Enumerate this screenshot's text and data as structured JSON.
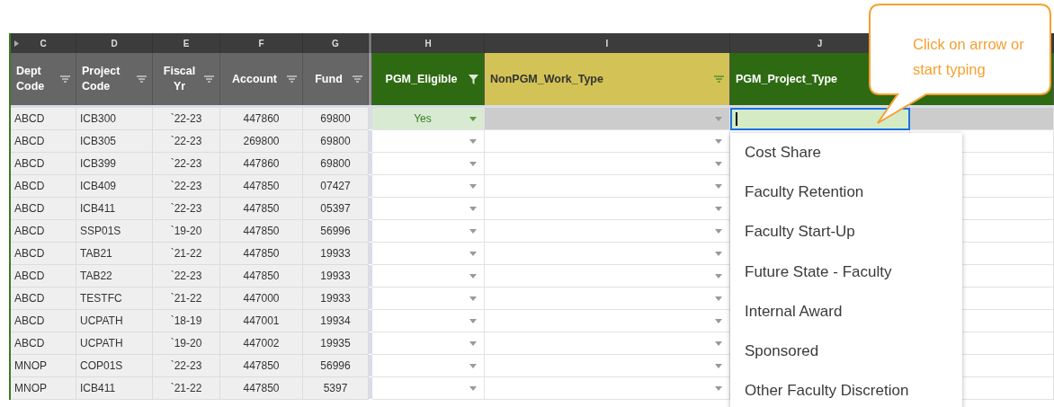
{
  "columns": [
    {
      "letter": "C",
      "label": "Dept Code",
      "color": "#666666",
      "filter_active": false
    },
    {
      "letter": "D",
      "label": "Project Code",
      "color": "#666666",
      "filter_active": false
    },
    {
      "letter": "E",
      "label": "Fiscal Yr",
      "color": "#666666",
      "filter_active": false
    },
    {
      "letter": "F",
      "label": "Account",
      "color": "#666666",
      "filter_active": false
    },
    {
      "letter": "G",
      "label": "Fund",
      "color": "#666666",
      "filter_active": false
    },
    {
      "letter": "H",
      "label": "PGM_Eligible",
      "color": "#2e6a12",
      "filter_active": true
    },
    {
      "letter": "I",
      "label": "NonPGM_Work_Type",
      "color": "#d3c356",
      "filter_active": false
    },
    {
      "letter": "J",
      "label": "PGM_Project_Type",
      "color": "#2e6a12"
    }
  ],
  "rows": [
    {
      "dept": "ABCD",
      "project": "ICB300",
      "fiscal": "`22-23",
      "account": "447860",
      "fund": "69800",
      "pgm_eligible": "Yes",
      "selected": true
    },
    {
      "dept": "ABCD",
      "project": "ICB305",
      "fiscal": "`22-23",
      "account": "269800",
      "fund": "69800",
      "selected": false
    },
    {
      "dept": "ABCD",
      "project": "ICB399",
      "fiscal": "`22-23",
      "account": "447860",
      "fund": "69800",
      "selected": false
    },
    {
      "dept": "ABCD",
      "project": "ICB409",
      "fiscal": "`22-23",
      "account": "447850",
      "fund": "07427",
      "selected": false
    },
    {
      "dept": "ABCD",
      "project": "ICB411",
      "fiscal": "`22-23",
      "account": "447850",
      "fund": "05397",
      "selected": false
    },
    {
      "dept": "ABCD",
      "project": "SSP01S",
      "fiscal": "`19-20",
      "account": "447850",
      "fund": "56996",
      "selected": false
    },
    {
      "dept": "ABCD",
      "project": "TAB21",
      "fiscal": "`21-22",
      "account": "447850",
      "fund": "19933",
      "selected": false
    },
    {
      "dept": "ABCD",
      "project": "TAB22",
      "fiscal": "`22-23",
      "account": "447850",
      "fund": "19933",
      "selected": false
    },
    {
      "dept": "ABCD",
      "project": "TESTFC",
      "fiscal": "`21-22",
      "account": "447000",
      "fund": "19933",
      "selected": false
    },
    {
      "dept": "ABCD",
      "project": "UCPATH",
      "fiscal": "`18-19",
      "account": "447001",
      "fund": "19934",
      "selected": false
    },
    {
      "dept": "ABCD",
      "project": "UCPATH",
      "fiscal": "`19-20",
      "account": "447002",
      "fund": "19935",
      "selected": false
    },
    {
      "dept": "MNOP",
      "project": "COP01S",
      "fiscal": "`22-23",
      "account": "447850",
      "fund": "56996",
      "selected": false
    },
    {
      "dept": "MNOP",
      "project": "ICB411",
      "fiscal": "`21-22",
      "account": "447850",
      "fund": "5397",
      "selected": false
    }
  ],
  "dropdown_options": [
    "Cost Share",
    "Faculty Retention",
    "Faculty Start-Up",
    "Future State - Faculty",
    "Internal Award",
    "Sponsored",
    "Other Faculty Discretion"
  ],
  "callout": {
    "text": "Click on arrow or start typing"
  }
}
